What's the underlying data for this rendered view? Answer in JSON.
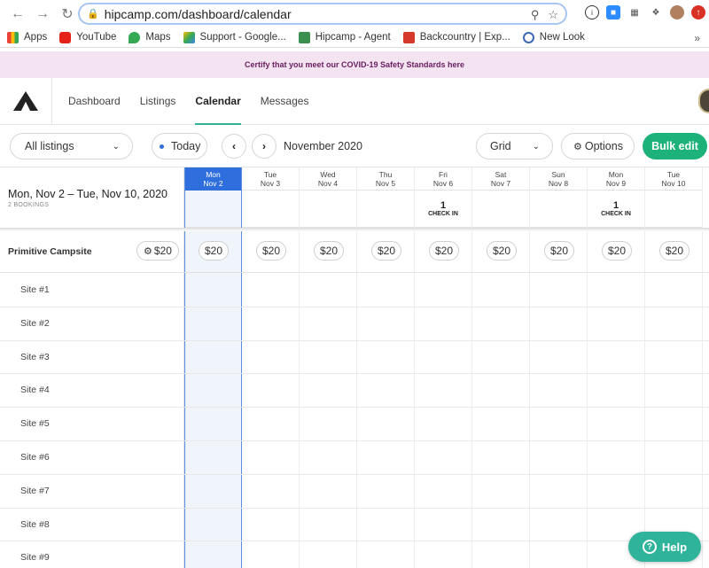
{
  "browser": {
    "url": "hipcamp.com/dashboard/calendar",
    "bookmarks": [
      "Apps",
      "YouTube",
      "Maps",
      "Support - Google...",
      "Hipcamp - Agent",
      "Backcountry | Exp...",
      "New Look"
    ],
    "more": "»"
  },
  "banner": {
    "text": "Certify that you meet our COVID-19 Safety Standards here"
  },
  "nav": {
    "links": [
      "Dashboard",
      "Listings",
      "Calendar",
      "Messages"
    ],
    "active": "Calendar"
  },
  "toolbar": {
    "listings": "All listings",
    "today": "Today",
    "prev": "‹",
    "next": "›",
    "month": "November 2020",
    "view": "Grid",
    "options": "Options",
    "bulk": "Bulk edit"
  },
  "calendar": {
    "range": "Mon, Nov 2 – Tue, Nov 10, 2020",
    "bookings": "2 BOOKINGS",
    "campsite": "Primitive Campsite",
    "campsite_price": "$20",
    "days": [
      {
        "dow": "Mon",
        "date": "Nov 2",
        "price": "$20",
        "checkin_count": "",
        "checkin_label": ""
      },
      {
        "dow": "Tue",
        "date": "Nov 3",
        "price": "$20",
        "checkin_count": "",
        "checkin_label": ""
      },
      {
        "dow": "Wed",
        "date": "Nov 4",
        "price": "$20",
        "checkin_count": "",
        "checkin_label": ""
      },
      {
        "dow": "Thu",
        "date": "Nov 5",
        "price": "$20",
        "checkin_count": "",
        "checkin_label": ""
      },
      {
        "dow": "Fri",
        "date": "Nov 6",
        "price": "$20",
        "checkin_count": "1",
        "checkin_label": "CHECK IN"
      },
      {
        "dow": "Sat",
        "date": "Nov 7",
        "price": "$20",
        "checkin_count": "",
        "checkin_label": ""
      },
      {
        "dow": "Sun",
        "date": "Nov 8",
        "price": "$20",
        "checkin_count": "",
        "checkin_label": ""
      },
      {
        "dow": "Mon",
        "date": "Nov 9",
        "price": "$20",
        "checkin_count": "1",
        "checkin_label": "CHECK IN"
      },
      {
        "dow": "Tue",
        "date": "Nov 10",
        "price": "$20",
        "checkin_count": "",
        "checkin_label": ""
      }
    ],
    "sites": [
      "Site #1",
      "Site #2",
      "Site #3",
      "Site #4",
      "Site #5",
      "Site #6",
      "Site #7",
      "Site #8",
      "Site #9"
    ]
  },
  "help": {
    "label": "Help",
    "icon": "?"
  },
  "colors": {
    "accent": "#1cb27a",
    "today": "#2f6fdd",
    "banner_bg": "#f4e3f1",
    "help": "#2fb39b"
  }
}
